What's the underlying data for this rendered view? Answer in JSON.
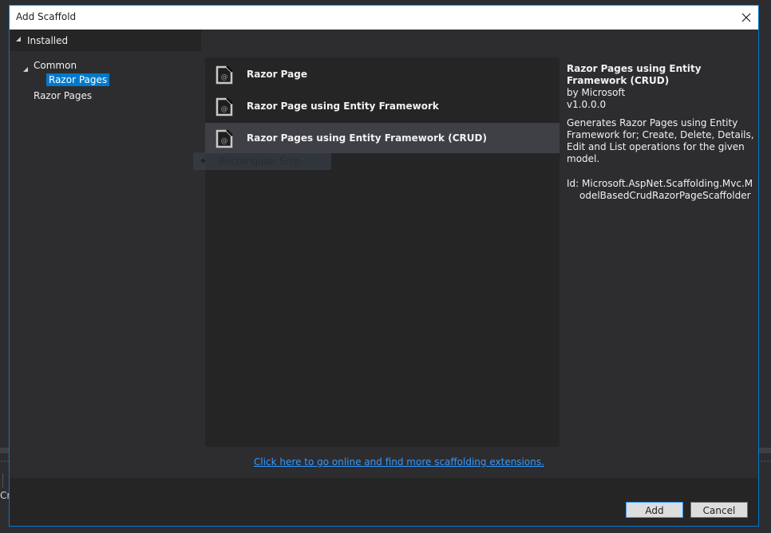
{
  "background": {
    "partial_text": "Cr"
  },
  "dialog": {
    "title": "Add Scaffold",
    "close_icon": "close-icon",
    "accent_color": "#007acc"
  },
  "tree": {
    "installed_label": "Installed",
    "items": [
      {
        "label": "Common",
        "expanded": true,
        "level": 1
      },
      {
        "label": "Razor Pages",
        "selected": true,
        "level": 2
      },
      {
        "label": "Razor Pages",
        "selected": false,
        "level": 1
      }
    ]
  },
  "templates": [
    {
      "label": "Razor Page",
      "icon": "razor-file-icon",
      "selected": false
    },
    {
      "label": "Razor Page using Entity Framework",
      "icon": "razor-file-icon",
      "selected": false
    },
    {
      "label": "Razor Pages using Entity Framework (CRUD)",
      "icon": "razor-file-icon",
      "selected": true
    }
  ],
  "overlay": {
    "snip_label": "Rectangular Snip"
  },
  "details": {
    "name": "Razor Pages using Entity Framework (CRUD)",
    "author": "by Microsoft",
    "version": "v1.0.0.0",
    "description": "Generates Razor Pages using Entity Framework for; Create, Delete, Details, Edit and List operations for the given model.",
    "id_label": "Id:",
    "id_value": "Microsoft.AspNet.Scaffolding.Mvc.ModelBasedCrudRazorPageScaffolder"
  },
  "online_link": "Click here to go online and find more scaffolding extensions.",
  "buttons": {
    "add": "Add",
    "cancel": "Cancel"
  }
}
